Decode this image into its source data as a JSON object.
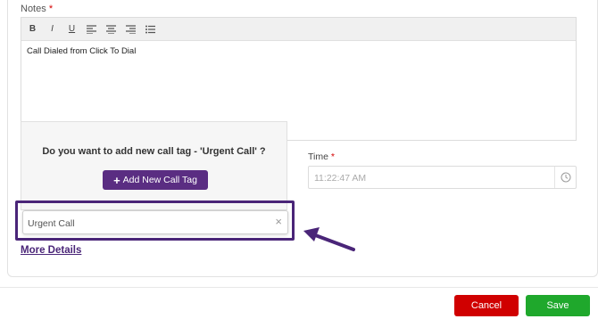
{
  "notes": {
    "label": "Notes",
    "required_mark": "*",
    "content": "Call Dialed from Click To Dial",
    "toolbar": {
      "bold": "B",
      "italic": "I",
      "underline": "U"
    }
  },
  "time": {
    "label": "Time",
    "required_mark": "*",
    "value": "11:22:47 AM"
  },
  "popover": {
    "question": "Do you want to add new call tag - 'Urgent Call' ?",
    "button_plus": "+",
    "button_label": "Add New Call Tag"
  },
  "call_tag": {
    "value": "Urgent Call",
    "clear": "×"
  },
  "more_details": "More Details",
  "footer": {
    "cancel": "Cancel",
    "save": "Save"
  },
  "colors": {
    "accent": "#5a2d82",
    "cancel": "#d00000",
    "save": "#1fa82c",
    "required": "#d40000"
  }
}
